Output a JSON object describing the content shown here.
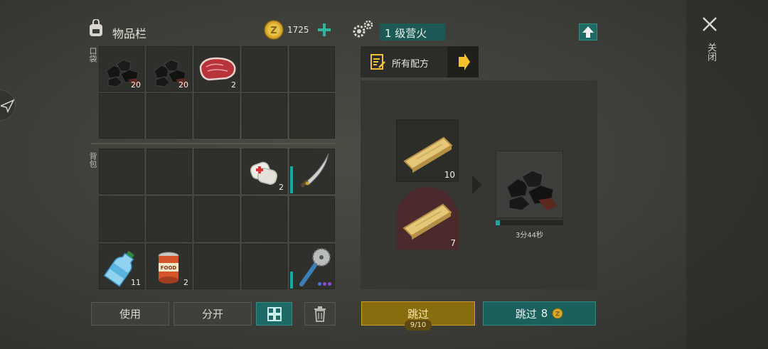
{
  "inventory": {
    "title": "物品栏",
    "coins": "1725",
    "pocket_label": "口袋",
    "backpack_label": "背包",
    "pocket_slots": [
      {
        "item": "coal-icon",
        "count": "20"
      },
      {
        "item": "coal-icon",
        "count": "20"
      },
      {
        "item": "raw-meat-icon",
        "count": "2"
      }
    ],
    "backpack_slots": [
      {
        "item": "bandage-icon",
        "count": "2"
      },
      {
        "item": "machete-icon",
        "durability": 0.62
      },
      {
        "item": "water-bottle-icon",
        "count": "11"
      },
      {
        "item": "canned-food-icon",
        "count": "2",
        "label": "FOOD"
      },
      {
        "item": "saw-club-icon",
        "durability": 0.4
      }
    ]
  },
  "buttons": {
    "use": "使用",
    "split": "分开"
  },
  "crafting": {
    "station": "1 级营火",
    "recipes_label": "所有配方",
    "inputs": [
      {
        "item": "wood-plank-icon",
        "count": "10"
      },
      {
        "item": "wood-plank-icon",
        "count": "7"
      }
    ],
    "output": {
      "item": "coal-icon",
      "progress": 0.06
    },
    "time": "3分44秒",
    "skip_label": "跳过",
    "skip_uses": "9/10",
    "skip_paid_label": "跳过",
    "skip_paid_cost": "8"
  },
  "close_label": "关闭",
  "colors": {
    "accent_teal": "#1e6b66",
    "gold": "#c9a227",
    "slot_bg": "#2f302c"
  }
}
